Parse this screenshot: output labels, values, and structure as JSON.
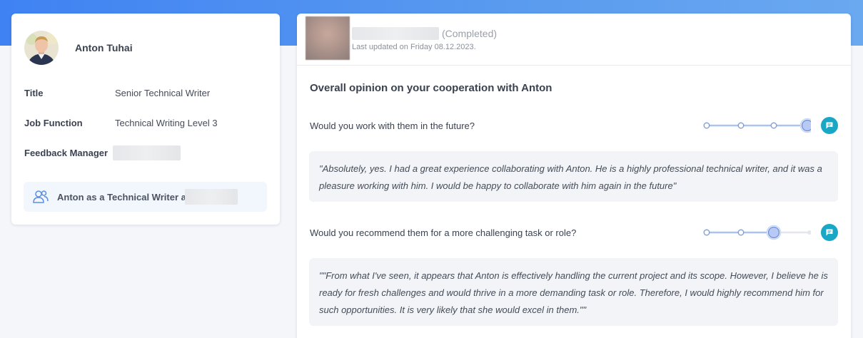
{
  "profile": {
    "name": "Anton Tuhai",
    "fields": [
      {
        "label": "Title",
        "value": "Senior Technical Writer"
      },
      {
        "label": "Job Function",
        "value": "Technical Writing Level 3"
      },
      {
        "label": "Feedback Manager",
        "value": ""
      }
    ],
    "role_label": "Anton as a Technical Writer at"
  },
  "feedback": {
    "status": "(Completed)",
    "last_updated": "Last updated on Friday 08.12.2023.",
    "section_title": "Overall opinion on your cooperation with Anton",
    "questions": [
      {
        "text": "Would you work with them in the future?",
        "rating": 4,
        "rating_max": 4,
        "answer": "\"Absolutely, yes. I had a great experience collaborating with Anton. He is a highly professional technical writer, and it was a pleasure working with him. I would be happy to collaborate with him again in the future\""
      },
      {
        "text": "Would you recommend them for a more challenging task or role?",
        "rating": 3,
        "rating_max": 4,
        "answer": "\"\"From what I've seen, it appears that Anton is effectively handling the current project and its scope. However, I believe he is ready for fresh challenges and would thrive in a more demanding task or role. Therefore, I would highly recommend him for such opportunities. It is very likely that she would excel in them.\"\""
      }
    ]
  },
  "colors": {
    "header_gradient_start": "#3f82f3",
    "header_gradient_end": "#6aa8f0",
    "slider_active": "#a9c4f1",
    "slider_thumb": "#b7c9f4",
    "comment_button": "#1aa7c6"
  }
}
